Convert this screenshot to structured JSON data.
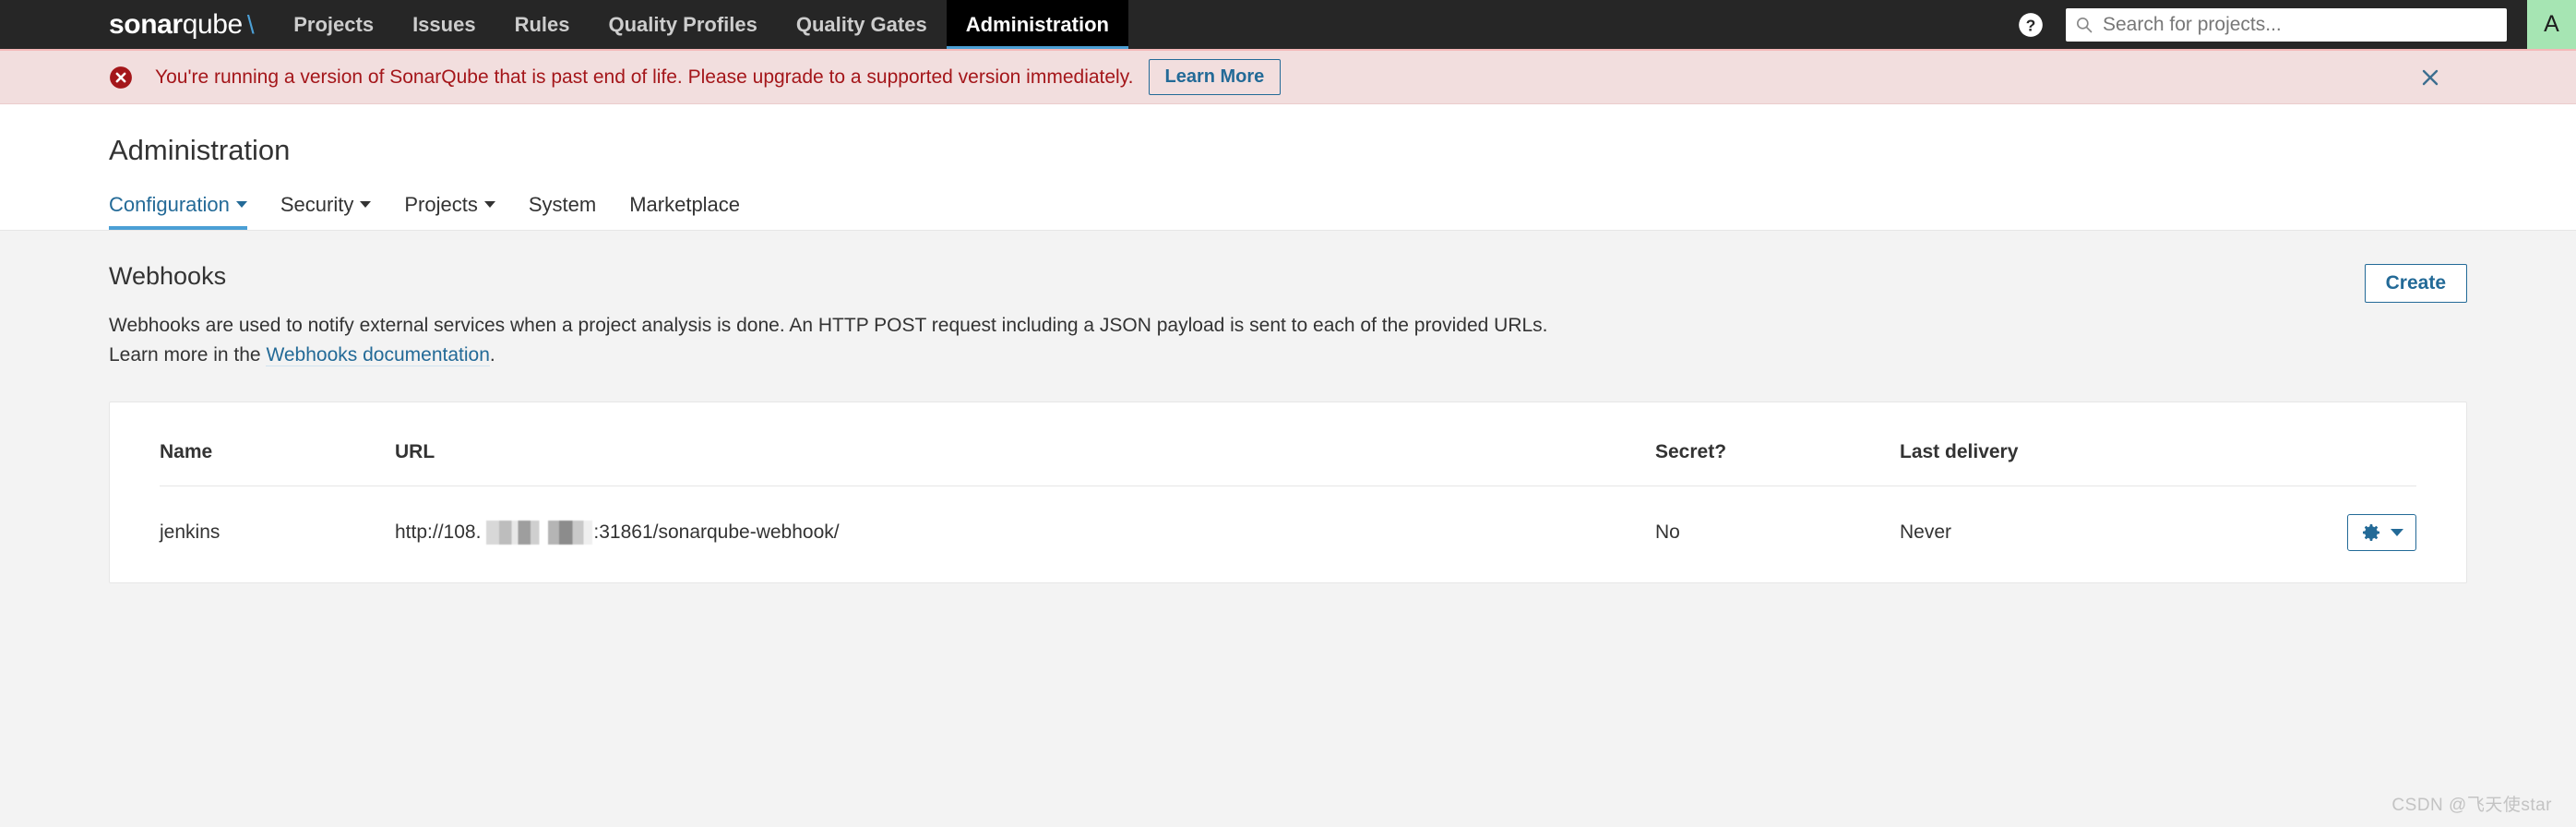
{
  "topbar": {
    "brand": {
      "bold": "sonar",
      "light": "qube",
      "slash": "\\"
    },
    "nav_items": [
      {
        "label": "Projects",
        "active": false
      },
      {
        "label": "Issues",
        "active": false
      },
      {
        "label": "Rules",
        "active": false
      },
      {
        "label": "Quality Profiles",
        "active": false
      },
      {
        "label": "Quality Gates",
        "active": false
      },
      {
        "label": "Administration",
        "active": true
      }
    ],
    "help_icon": "help-circle-icon",
    "search": {
      "icon": "search-icon",
      "placeholder": "Search for projects...",
      "value": ""
    },
    "avatar": {
      "initial": "A",
      "color": "#a6e5b3"
    }
  },
  "banner": {
    "icon": "error-circle-icon",
    "message": "You're running a version of SonarQube that is past end of life. Please upgrade to a supported version immediately.",
    "action_label": "Learn More",
    "close_icon": "close-icon",
    "background": "#f2dede",
    "text_color": "#a4161a"
  },
  "page": {
    "title": "Administration",
    "tabs": [
      {
        "label": "Configuration",
        "has_caret": true,
        "active": true
      },
      {
        "label": "Security",
        "has_caret": true,
        "active": false
      },
      {
        "label": "Projects",
        "has_caret": true,
        "active": false
      },
      {
        "label": "System",
        "has_caret": false,
        "active": false
      },
      {
        "label": "Marketplace",
        "has_caret": false,
        "active": false
      }
    ]
  },
  "webhooks": {
    "heading": "Webhooks",
    "create_label": "Create",
    "description_part1": "Webhooks are used to notify external services when a project analysis is done. An HTTP POST request including a JSON payload is sent to each of the provided URLs. Learn more in the ",
    "description_link": "Webhooks documentation",
    "description_part2": ".",
    "columns": [
      "Name",
      "URL",
      "Secret?",
      "Last delivery"
    ],
    "rows": [
      {
        "name": "jenkins",
        "url_prefix": "http://108.",
        "url_redacted": true,
        "url_suffix": ":31861/sonarqube-webhook/",
        "secret": "No",
        "last_delivery": "Never",
        "actions_icon": "gear-icon",
        "actions_caret": "chevron-down-icon"
      }
    ]
  },
  "watermark": "CSDN @飞天使star"
}
